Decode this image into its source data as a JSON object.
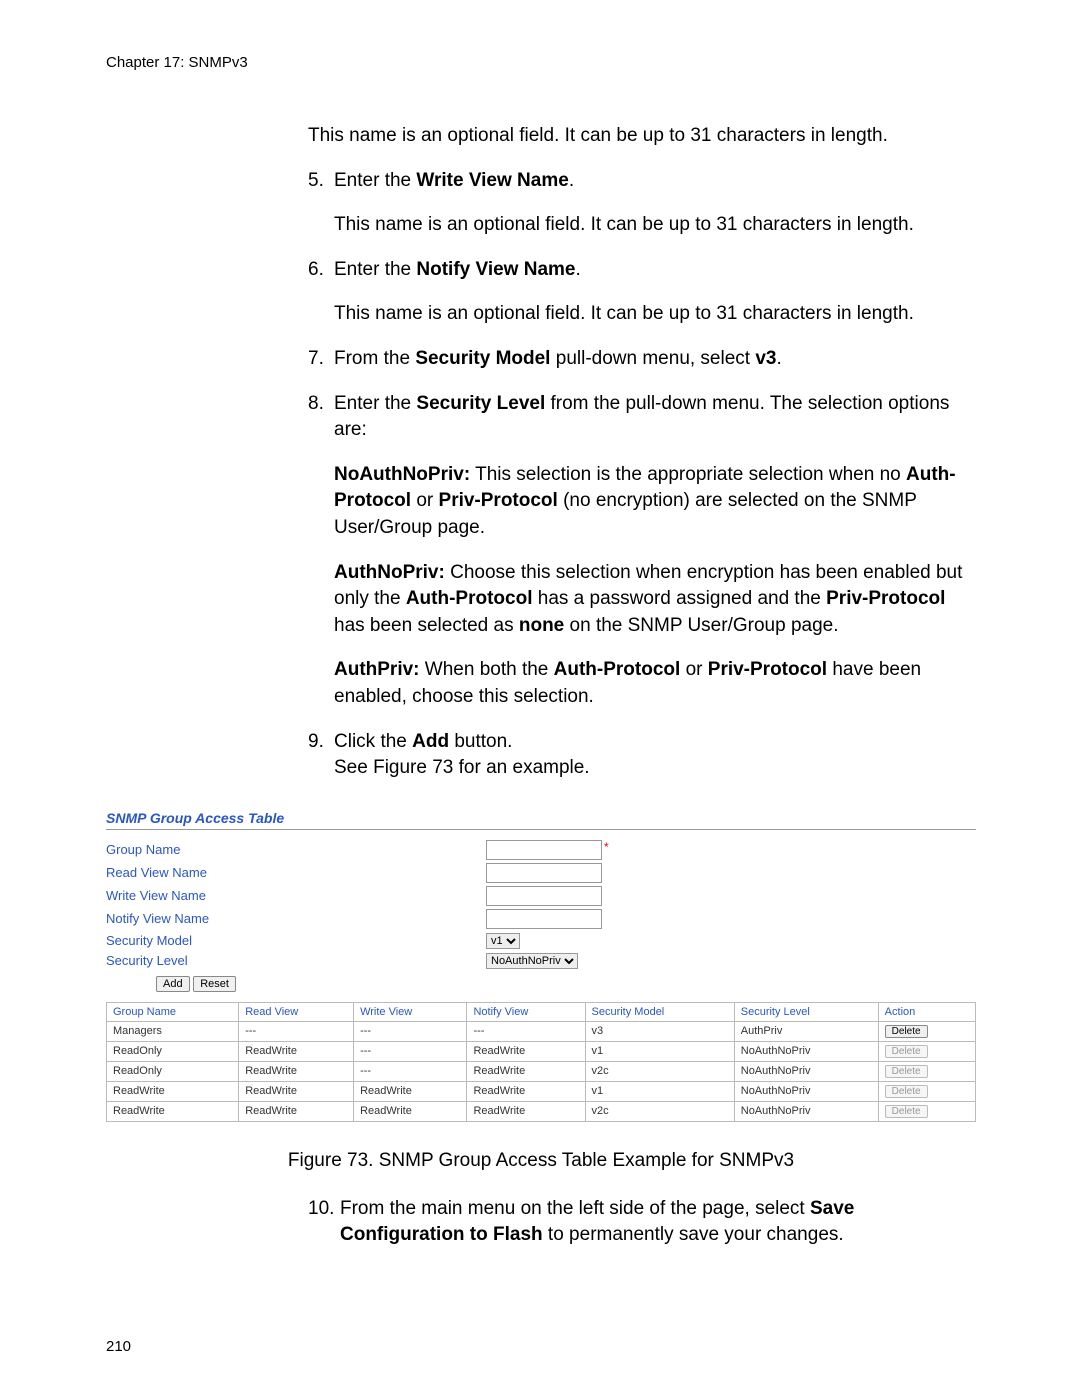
{
  "chapter_label": "Chapter 17: SNMPv3",
  "intro_para": "This name is an optional field. It can be up to 31 characters in length.",
  "steps": {
    "s5_num": "5.",
    "s5_pre": "Enter the ",
    "s5_bold": "Write View Name",
    "s5_post": ".",
    "s5_after": "This name is an optional field. It can be up to 31 characters in length.",
    "s6_num": "6.",
    "s6_pre": "Enter the ",
    "s6_bold": "Notify View Name",
    "s6_post": ".",
    "s6_after": "This name is an optional field. It can be up to 31 characters in length.",
    "s7_num": "7.",
    "s7_pre": "From the ",
    "s7_bold1": "Security Model",
    "s7_mid": " pull-down menu, select ",
    "s7_bold2": "v3",
    "s7_post": ".",
    "s8_num": "8.",
    "s8_pre": "Enter the ",
    "s8_bold": "Security Level",
    "s8_post": " from the pull-down menu. The selection options are:",
    "s8a_bold": "NoAuthNoPriv:",
    "s8a_t1": " This selection is the appropriate selection when no ",
    "s8a_b2": "Auth-Protocol",
    "s8a_t2": " or ",
    "s8a_b3": "Priv-Protocol",
    "s8a_t3": " (no encryption) are selected on the SNMP User/Group page.",
    "s8b_bold": "AuthNoPriv:",
    "s8b_t1": " Choose this selection when encryption has been enabled but only the ",
    "s8b_b2": "Auth-Protocol",
    "s8b_t2": " has a password assigned and the ",
    "s8b_b3": "Priv-Protocol",
    "s8b_t3": " has been selected as ",
    "s8b_b4": "none",
    "s8b_t4": " on the SNMP User/Group page.",
    "s8c_bold": "AuthPriv:",
    "s8c_t1": " When both the ",
    "s8c_b2": "Auth-Protocol",
    "s8c_t2": " or ",
    "s8c_b3": "Priv-Protocol",
    "s8c_t3": " have been enabled, choose this selection.",
    "s9_num": "9.",
    "s9_pre": "Click the ",
    "s9_bold": "Add",
    "s9_post": " button.",
    "s9_line2": "See Figure 73 for an example.",
    "s10_num": "10.",
    "s10_pre": "From the main menu on the left side of the page, select ",
    "s10_bold": "Save Configuration to Flash",
    "s10_post": " to permanently save your changes."
  },
  "screenshot": {
    "title": "SNMP Group Access Table",
    "labels": {
      "group_name": "Group Name",
      "read_view": "Read View Name",
      "write_view": "Write View Name",
      "notify_view": "Notify View Name",
      "sec_model": "Security Model",
      "sec_level": "Security Level"
    },
    "sec_model_selected": "v1",
    "sec_level_selected": "NoAuthNoPriv",
    "buttons": {
      "add": "Add",
      "reset": "Reset"
    },
    "table": {
      "headers": [
        "Group Name",
        "Read View",
        "Write View",
        "Notify View",
        "Security Model",
        "Security Level",
        "Action"
      ],
      "rows": [
        {
          "c": [
            "Managers",
            "---",
            "---",
            "---",
            "v3",
            "AuthPriv"
          ],
          "del_enabled": true
        },
        {
          "c": [
            "ReadOnly",
            "ReadWrite",
            "---",
            "ReadWrite",
            "v1",
            "NoAuthNoPriv"
          ],
          "del_enabled": false
        },
        {
          "c": [
            "ReadOnly",
            "ReadWrite",
            "---",
            "ReadWrite",
            "v2c",
            "NoAuthNoPriv"
          ],
          "del_enabled": false
        },
        {
          "c": [
            "ReadWrite",
            "ReadWrite",
            "ReadWrite",
            "ReadWrite",
            "v1",
            "NoAuthNoPriv"
          ],
          "del_enabled": false
        },
        {
          "c": [
            "ReadWrite",
            "ReadWrite",
            "ReadWrite",
            "ReadWrite",
            "v2c",
            "NoAuthNoPriv"
          ],
          "del_enabled": false
        }
      ],
      "delete_label": "Delete"
    }
  },
  "caption": "Figure 73. SNMP Group Access Table Example for SNMPv3",
  "page_number": "210"
}
